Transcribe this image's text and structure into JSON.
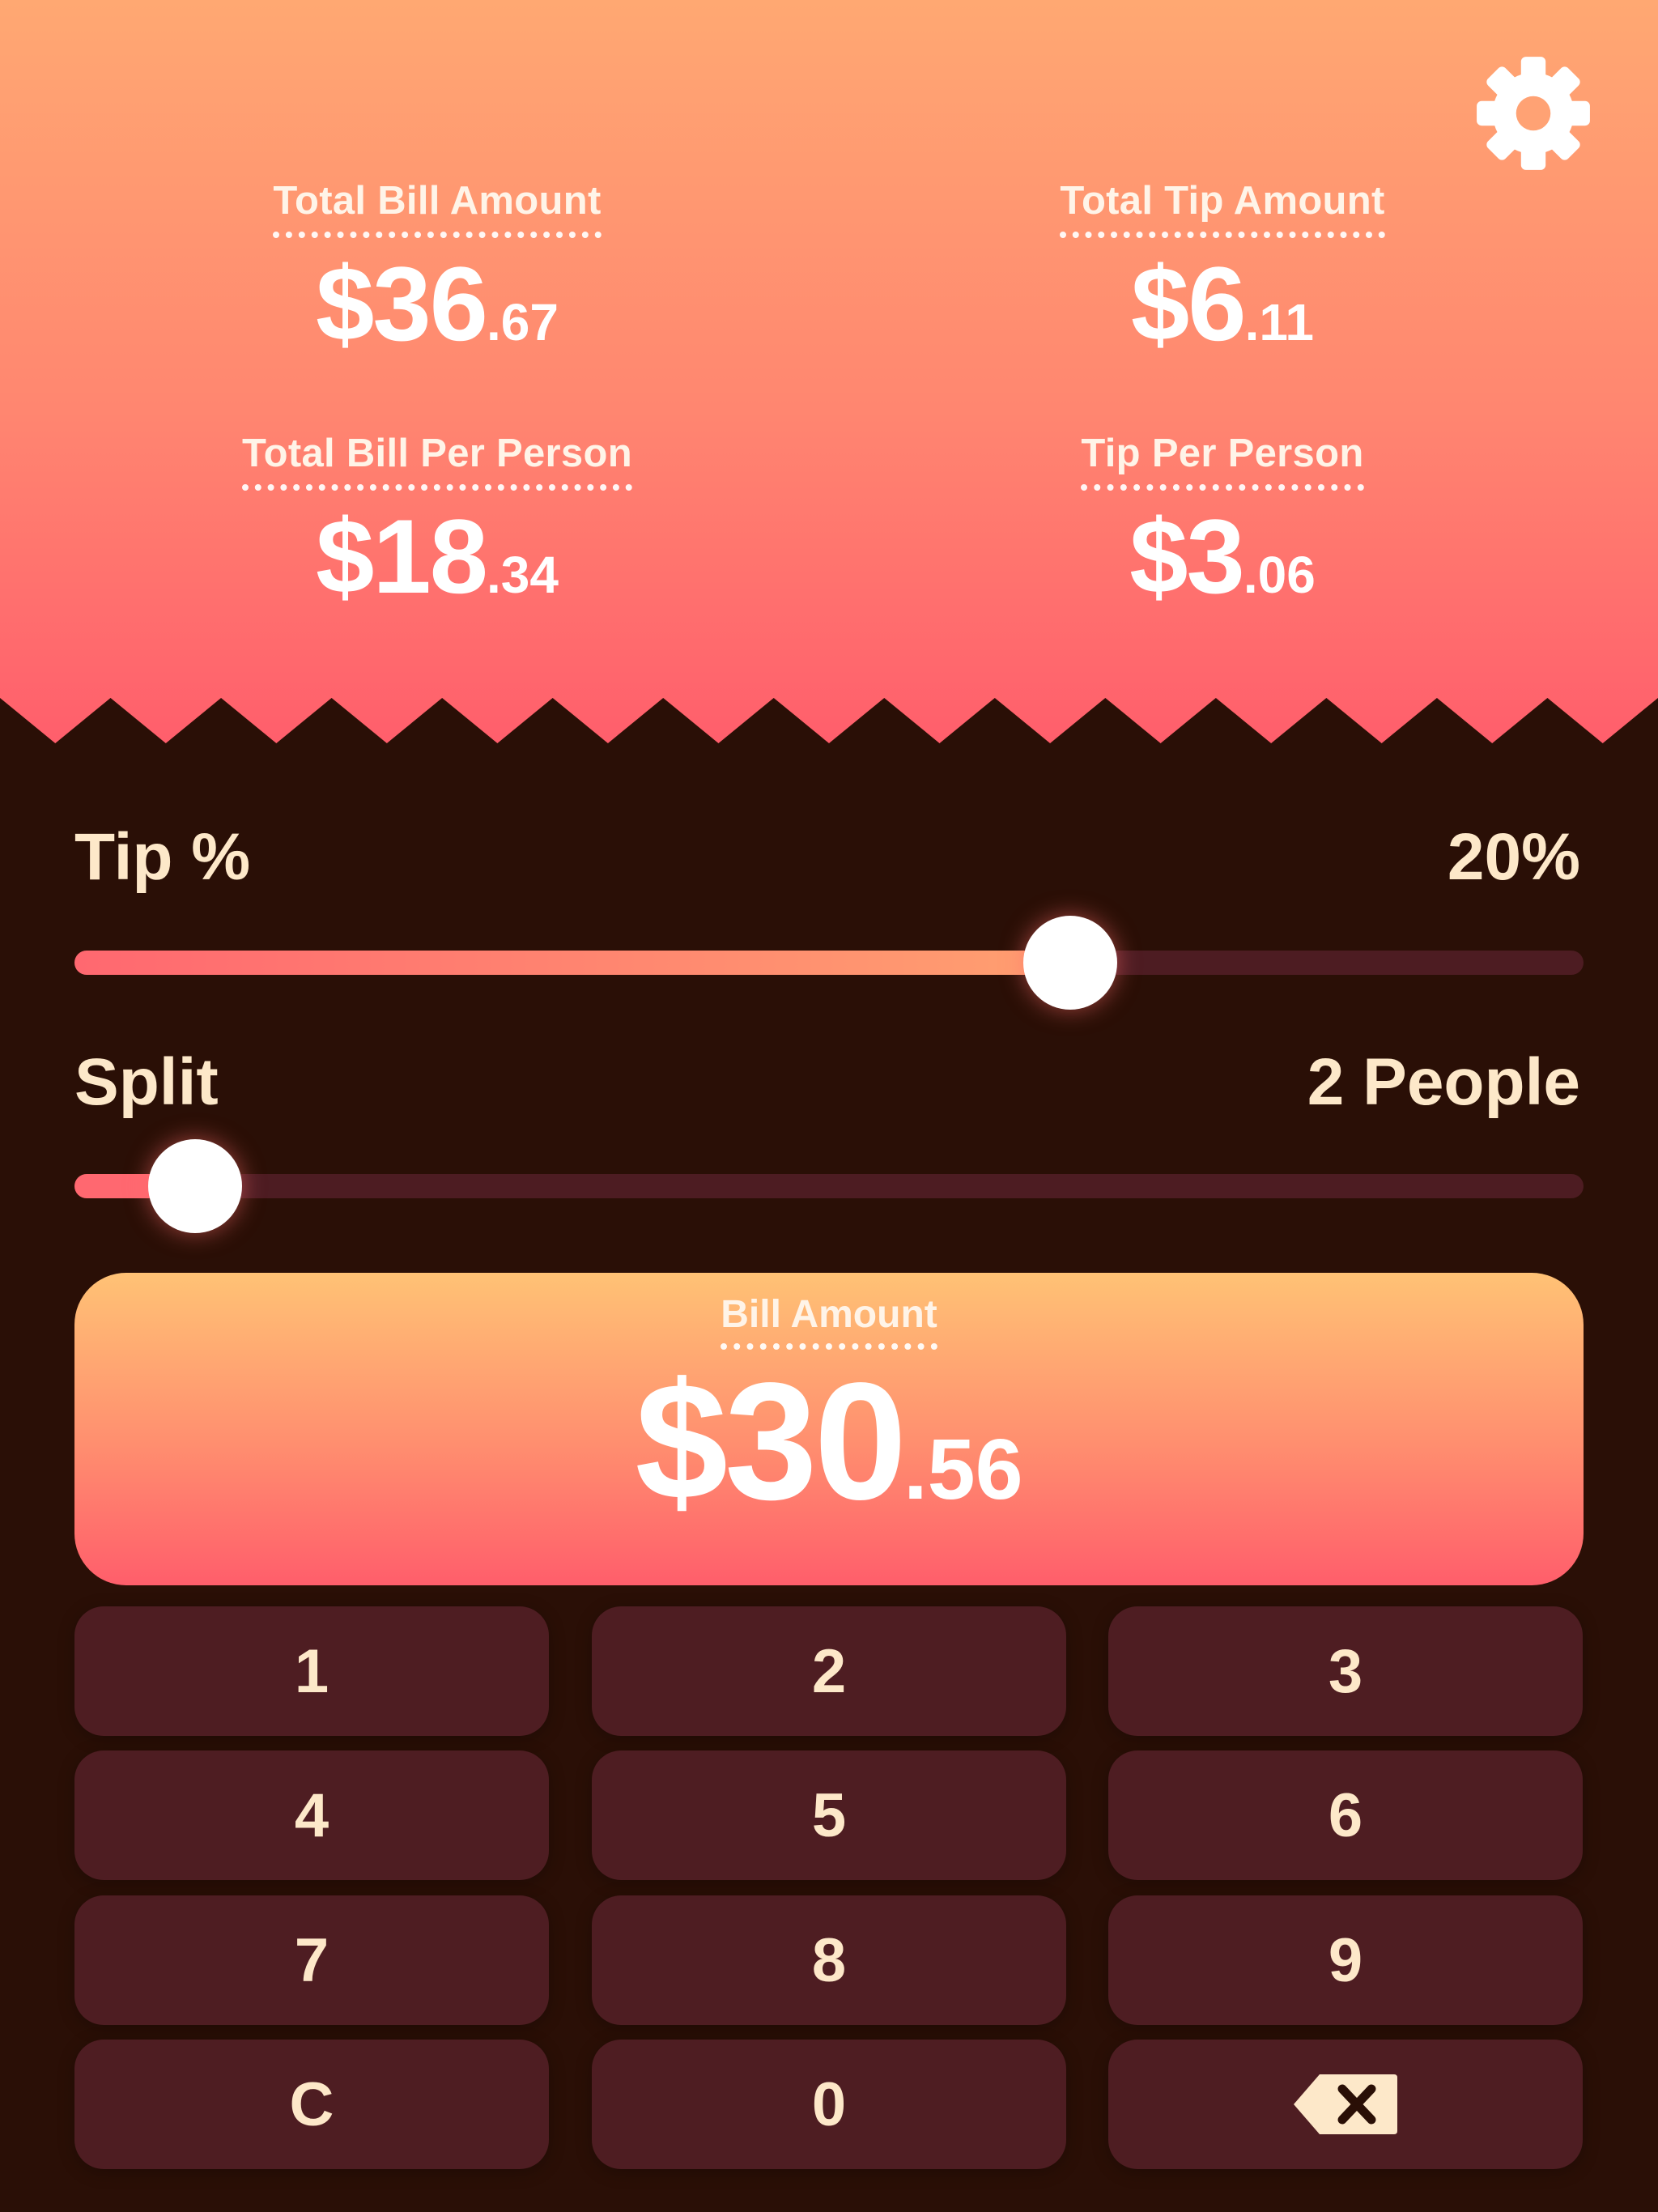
{
  "stats": {
    "total_bill": {
      "label": "Total Bill Amount",
      "dollars": "$36",
      "cents": ".67"
    },
    "total_tip": {
      "label": "Total Tip Amount",
      "dollars": "$6",
      "cents": ".11"
    },
    "bill_per_person": {
      "label": "Total Bill Per Person",
      "dollars": "$18",
      "cents": ".34"
    },
    "tip_per_person": {
      "label": "Tip Per Person",
      "dollars": "$3",
      "cents": ".06"
    }
  },
  "tip": {
    "label": "Tip %",
    "value_text": "20%",
    "slider_fraction": 0.66
  },
  "split": {
    "label": "Split",
    "value_text": "2 People",
    "slider_fraction": 0.08
  },
  "bill": {
    "label": "Bill Amount",
    "dollars": "$30",
    "cents": ".56"
  },
  "keypad": {
    "keys": [
      "1",
      "2",
      "3",
      "4",
      "5",
      "6",
      "7",
      "8",
      "9",
      "C",
      "0"
    ]
  },
  "icons": {
    "settings": "gear-icon",
    "backspace": "backspace-icon"
  },
  "colors": {
    "accent_pink": "#ff6870",
    "accent_orange": "#ffa06f",
    "background_dark": "#2a0f06",
    "key_background": "#4e1d22",
    "text_cream": "#fde8c9"
  }
}
